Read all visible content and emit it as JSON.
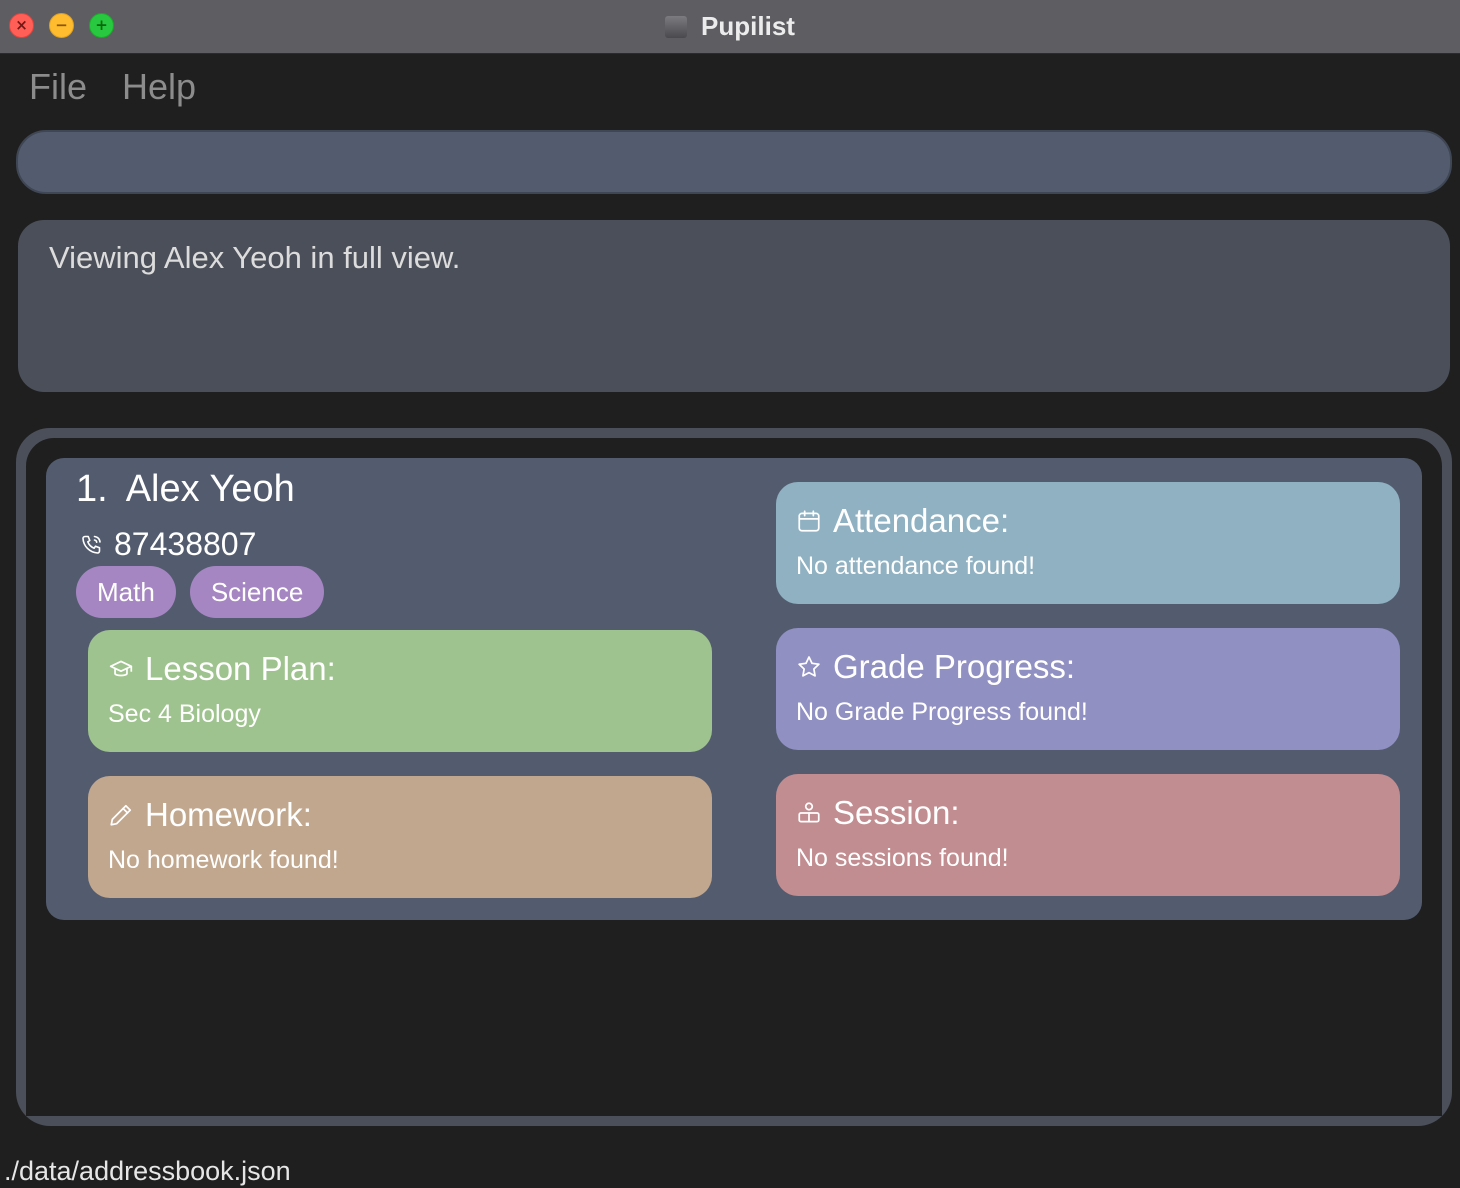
{
  "window": {
    "title": "Pupilist",
    "close_glyph": "×",
    "minimize_glyph": "−",
    "maximize_glyph": "+"
  },
  "menu": {
    "items": [
      {
        "label": "File"
      },
      {
        "label": "Help"
      }
    ]
  },
  "command_box": {
    "value": "",
    "placeholder": ""
  },
  "result": {
    "message": "Viewing Alex Yeoh in full view."
  },
  "person": {
    "index": "1.",
    "name": "Alex Yeoh",
    "phone": "87438807",
    "phone_icon": "phone-icon",
    "tags": [
      "Math",
      "Science"
    ],
    "sections": {
      "lesson_plan": {
        "title": "Lesson Plan:",
        "body": "Sec 4 Biology",
        "icon": "graduation-cap-icon",
        "color": "#9ec38e"
      },
      "homework": {
        "title": "Homework:",
        "body": "No homework found!",
        "icon": "pencil-icon",
        "color": "#c2a78f"
      },
      "attendance": {
        "title": "Attendance:",
        "body": "No attendance found!",
        "icon": "calendar-icon",
        "color": "#8fb1c2"
      },
      "grade_progress": {
        "title": "Grade Progress:",
        "body": "No Grade Progress found!",
        "icon": "star-icon",
        "color": "#9190c2"
      },
      "session": {
        "title": "Session:",
        "body": "No sessions found!",
        "icon": "session-icon",
        "color": "#c28d90"
      }
    }
  },
  "status_bar": {
    "path": "./data/addressbook.json"
  },
  "colors": {
    "background": "#1f1f1f",
    "title_bar": "#5e5d62",
    "command_box": "#535c6f",
    "result_box": "#4b4f59",
    "card": "#535c6f",
    "tag": "#a686c2"
  }
}
